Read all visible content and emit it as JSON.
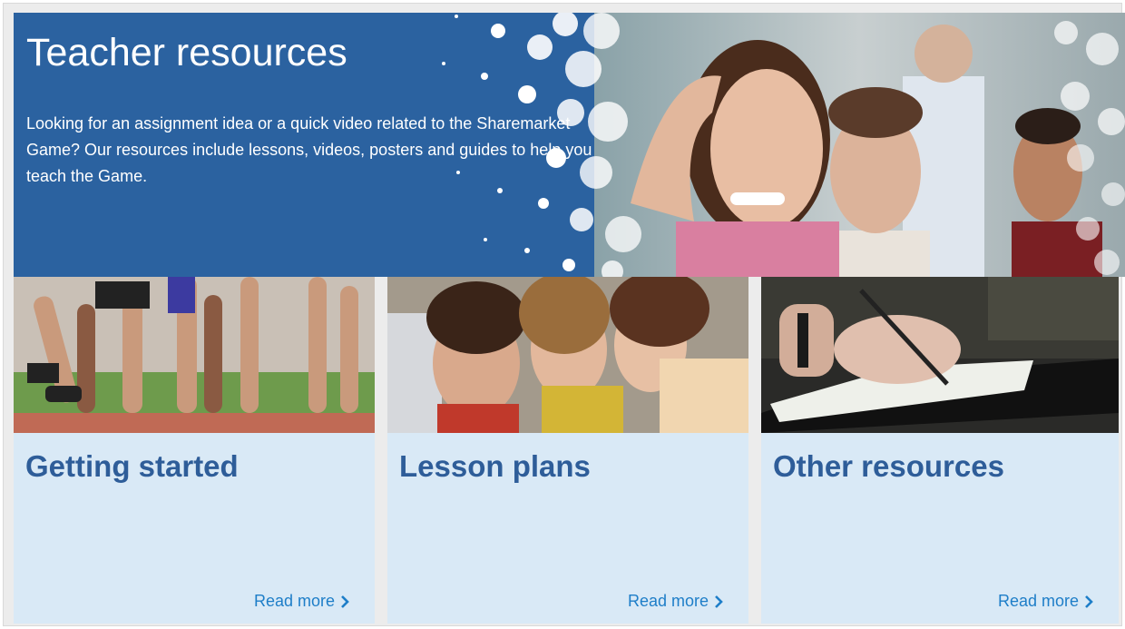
{
  "hero": {
    "title": "Teacher resources",
    "text": "Looking for an assignment idea or a quick video related to the Sharemarket Game? Our resources include lessons, videos, posters and guides to help you teach the Game."
  },
  "cards": [
    {
      "title": "Getting started",
      "link": "Read more",
      "image": "runners-starting-line-photo"
    },
    {
      "title": "Lesson plans",
      "link": "Read more",
      "image": "students-at-laptop-photo"
    },
    {
      "title": "Other resources",
      "link": "Read more",
      "image": "hand-writing-notebook-photo"
    }
  ],
  "colors": {
    "hero_bg": "#2b62a0",
    "card_bg": "#d9e9f6",
    "title": "#2e5d99",
    "link": "#1e7ec8"
  }
}
